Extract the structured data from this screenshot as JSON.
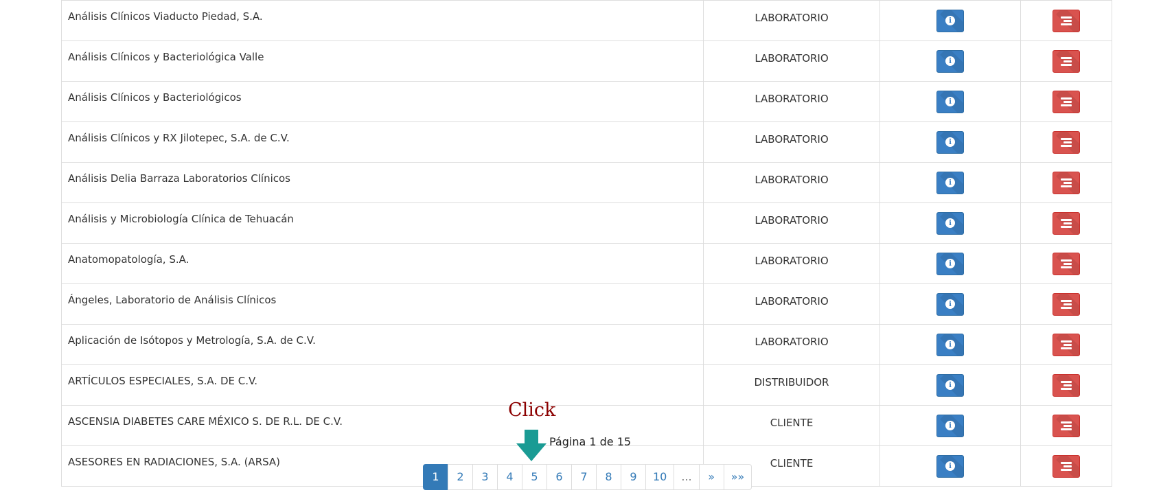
{
  "rows": [
    {
      "name": "Análisis Clínicos Viaducto Piedad, S.A.",
      "type": "LABORATORIO"
    },
    {
      "name": "Análisis Clínicos y Bacteriológica Valle",
      "type": "LABORATORIO"
    },
    {
      "name": "Análisis Clínicos y Bacteriológicos",
      "type": "LABORATORIO"
    },
    {
      "name": "Análisis Clínicos y RX Jilotepec, S.A. de C.V.",
      "type": "LABORATORIO"
    },
    {
      "name": "Análisis Delia Barraza Laboratorios Clínicos",
      "type": "LABORATORIO"
    },
    {
      "name": "Análisis y Microbiología Clínica de Tehuacán",
      "type": "LABORATORIO"
    },
    {
      "name": "Anatomopatología, S.A.",
      "type": "LABORATORIO"
    },
    {
      "name": "Ángeles, Laboratorio de Análisis Clínicos",
      "type": "LABORATORIO"
    },
    {
      "name": "Aplicación de Isótopos y Metrología, S.A. de C.V.",
      "type": "LABORATORIO"
    },
    {
      "name": "ARTÍCULOS ESPECIALES, S.A. DE C.V.",
      "type": "DISTRIBUIDOR"
    },
    {
      "name": "ASCENSIA DIABETES CARE MÉXICO S. DE R.L. DE C.V.",
      "type": "CLIENTE"
    },
    {
      "name": "ASESORES EN RADIACIONES, S.A. (ARSA)",
      "type": "CLIENTE"
    }
  ],
  "icons": {
    "info": "info-circle-icon",
    "list": "list-icon"
  },
  "colors": {
    "info_button": "#3a7fc4",
    "danger_button": "#d9534f",
    "pagination_active": "#337ab7",
    "annotation_text": "#8b0000",
    "annotation_arrow": "#1a9b94"
  },
  "annotation": {
    "label": "Click",
    "arrow_icon": "arrow-down-icon"
  },
  "pagination": {
    "info": "Página 1 de 15",
    "pages": [
      "1",
      "2",
      "3",
      "4",
      "5",
      "6",
      "7",
      "8",
      "9",
      "10",
      "...",
      "»",
      "»»"
    ],
    "active_index": 0,
    "ellipsis_index": 10
  }
}
